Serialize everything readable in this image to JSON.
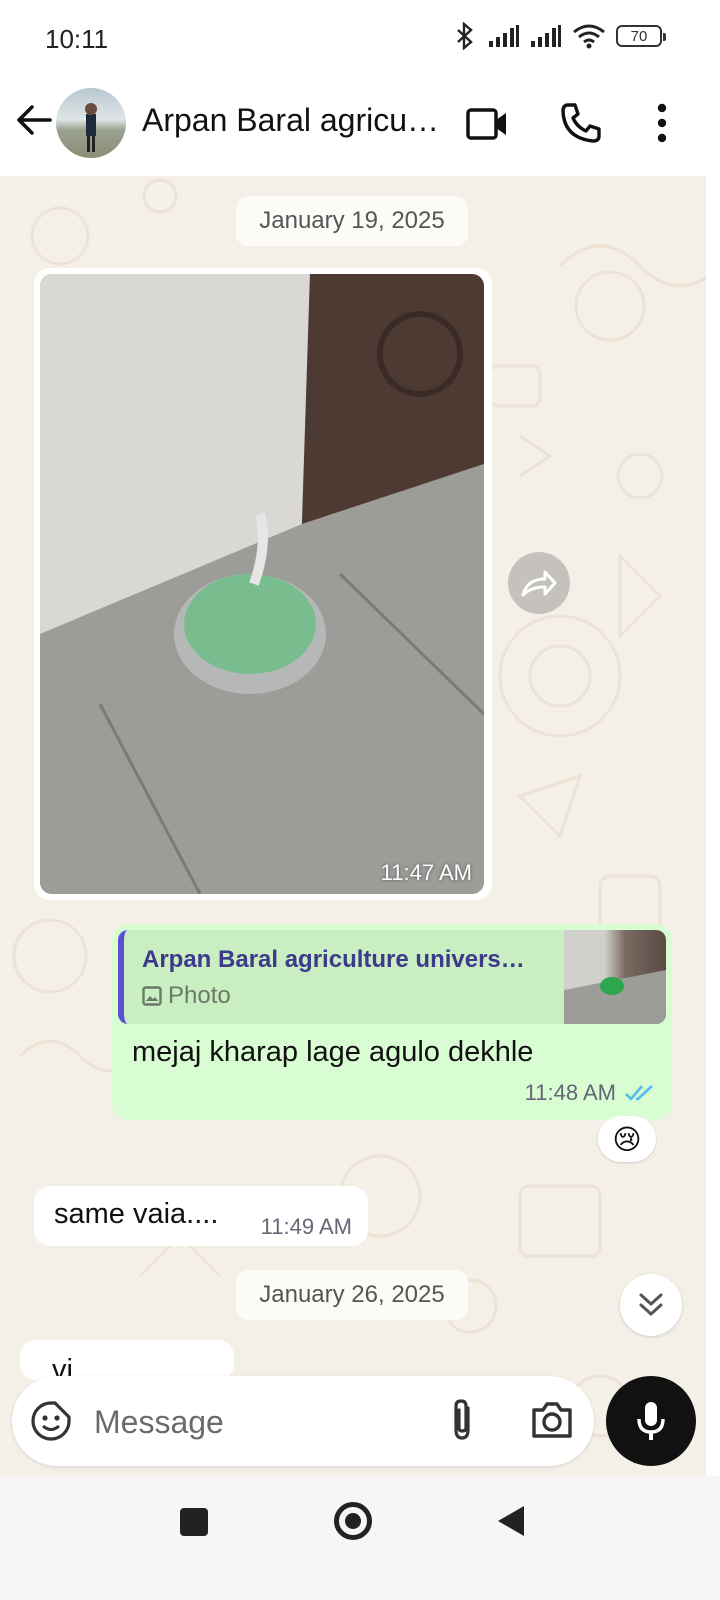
{
  "status_bar": {
    "time": "10:11",
    "battery": "70",
    "icons": [
      "bluetooth-icon",
      "signal-icon",
      "signal-icon",
      "wifi-icon",
      "battery-icon"
    ]
  },
  "header": {
    "contact_name": "Arpan Baral agricu…",
    "icons": [
      "back-arrow-icon",
      "video-call-icon",
      "voice-call-icon",
      "more-vert-icon"
    ]
  },
  "chat": {
    "date_1": "January 19, 2025",
    "photo_message": {
      "time": "11:47 AM"
    },
    "reply_message": {
      "quoted_name": "Arpan Baral agriculture univers…",
      "quoted_type": "Photo",
      "text": "mejaj kharap lage agulo dekhle",
      "time": "11:48 AM",
      "status": "read",
      "reaction": "😢"
    },
    "incoming_message": {
      "text": "same vaia....",
      "time": "11:49 AM"
    },
    "date_2": "January 26, 2025",
    "partial_message": {
      "text": "vi"
    }
  },
  "input": {
    "placeholder": "Message",
    "icons": [
      "sticker-icon",
      "attach-icon",
      "camera-icon",
      "mic-icon"
    ]
  },
  "colors": {
    "chat_bg": "#f4efe7",
    "outgoing_bubble": "#d9fdd3",
    "quote_bar": "#5b4fd3",
    "read_ticks": "#53bdeb"
  }
}
